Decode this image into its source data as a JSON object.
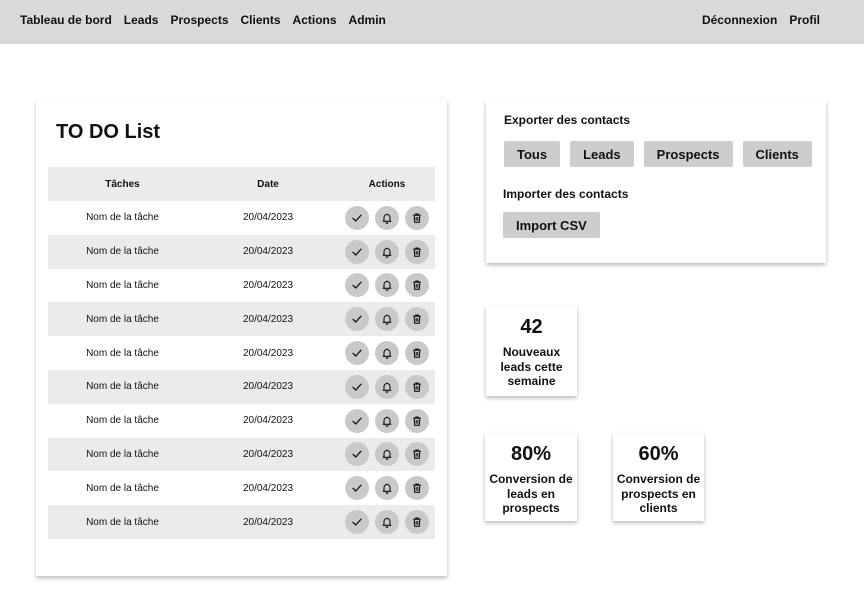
{
  "nav": {
    "left": [
      "Tableau de bord",
      "Leads",
      "Prospects",
      "Clients",
      "Actions",
      "Admin"
    ],
    "right": [
      "Déconnexion",
      "Profil"
    ]
  },
  "todo": {
    "title": "TO DO List",
    "headers": {
      "task": "Tâches",
      "date": "Date",
      "actions": "Actions"
    },
    "rows": [
      {
        "task": "Nom de la tâche",
        "date": "20/04/2023"
      },
      {
        "task": "Nom de la tâche",
        "date": "20/04/2023"
      },
      {
        "task": "Nom de la tâche",
        "date": "20/04/2023"
      },
      {
        "task": "Nom de la tâche",
        "date": "20/04/2023"
      },
      {
        "task": "Nom de la tâche",
        "date": "20/04/2023"
      },
      {
        "task": "Nom de la tâche",
        "date": "20/04/2023"
      },
      {
        "task": "Nom de la tâche",
        "date": "20/04/2023"
      },
      {
        "task": "Nom de la tâche",
        "date": "20/04/2023"
      },
      {
        "task": "Nom de la tâche",
        "date": "20/04/2023"
      },
      {
        "task": "Nom de la tâche",
        "date": "20/04/2023"
      }
    ],
    "row_actions": [
      "check-icon",
      "bell-icon",
      "trash-icon"
    ]
  },
  "export": {
    "title": "Exporter des contacts",
    "buttons": [
      "Tous",
      "Leads",
      "Prospects",
      "Clients"
    ]
  },
  "import": {
    "title": "Importer des contacts",
    "button": "Import CSV"
  },
  "stats": {
    "new_leads": {
      "value": "42",
      "label": "Nouveaux leads cette semaine"
    },
    "leads_conversion": {
      "value": "80%",
      "label": "Conversion de leads en prospects"
    },
    "prospects_conversion": {
      "value": "60%",
      "label": "Conversion de prospects en clients"
    }
  },
  "colors": {
    "topbar": "#d9d9d9",
    "row_alt": "#ebebeb",
    "button": "#cdcdcd"
  }
}
